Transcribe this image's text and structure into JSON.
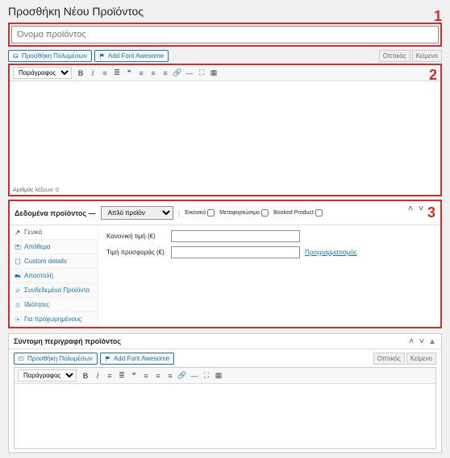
{
  "page_title": "Προσθήκη Νέου Προϊόντος",
  "markers": {
    "one": "1",
    "two": "2",
    "three": "3"
  },
  "title_input": {
    "placeholder": "Όνομα προϊόντος"
  },
  "media_buttons": {
    "add_media": "Προσθήκη Πολυμέσων",
    "add_font": "Add Font Awesome"
  },
  "editor_tabs": {
    "visual": "Οπτικός",
    "text": "Κείμενο"
  },
  "editor": {
    "paragraph": "Παράγραφος",
    "word_count": "Αριθμός λέξεων: 0"
  },
  "product_data": {
    "header_label": "Δεδομένα προϊόντος —",
    "type_selected": "Απλό προϊόν",
    "checks": {
      "virtual": "Εικονικό",
      "downloadable": "Μεταφορτώσιμο",
      "booked": "Booked Product"
    },
    "tabs": [
      "Γενικά",
      "Απόθεμα",
      "Custom details",
      "Αποστολή",
      "Συνδεδεμένα Προϊόντα",
      "Ιδιότητες",
      "Για προχωρημένους"
    ],
    "fields": {
      "regular_price": "Κανονική τιμή (€)",
      "sale_price": "Τιμή προσφοράς (€)",
      "schedule": "Προγραμματισμός"
    }
  },
  "short_desc": {
    "title": "Σύντομη περιγραφή προϊόντος"
  }
}
